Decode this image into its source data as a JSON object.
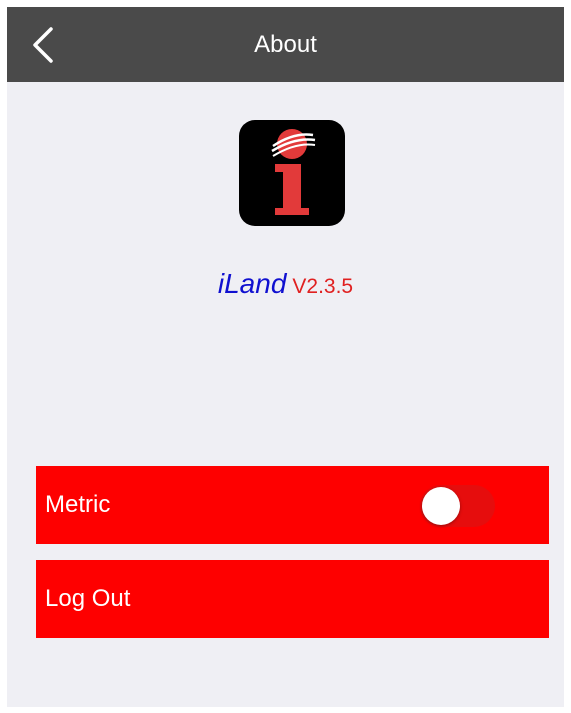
{
  "header": {
    "title": "About",
    "back_icon": "chevron-left-icon"
  },
  "app": {
    "icon": "iland-logo-icon",
    "name": "iLand",
    "version": "V2.3.5"
  },
  "settings": {
    "metric": {
      "label": "Metric",
      "enabled": false
    },
    "logout": {
      "label": "Log Out"
    }
  },
  "colors": {
    "navbar": "#4a4a4a",
    "background": "#efeff4",
    "row": "#fe0000",
    "app_name": "#1010d0",
    "app_version": "#e02020"
  }
}
